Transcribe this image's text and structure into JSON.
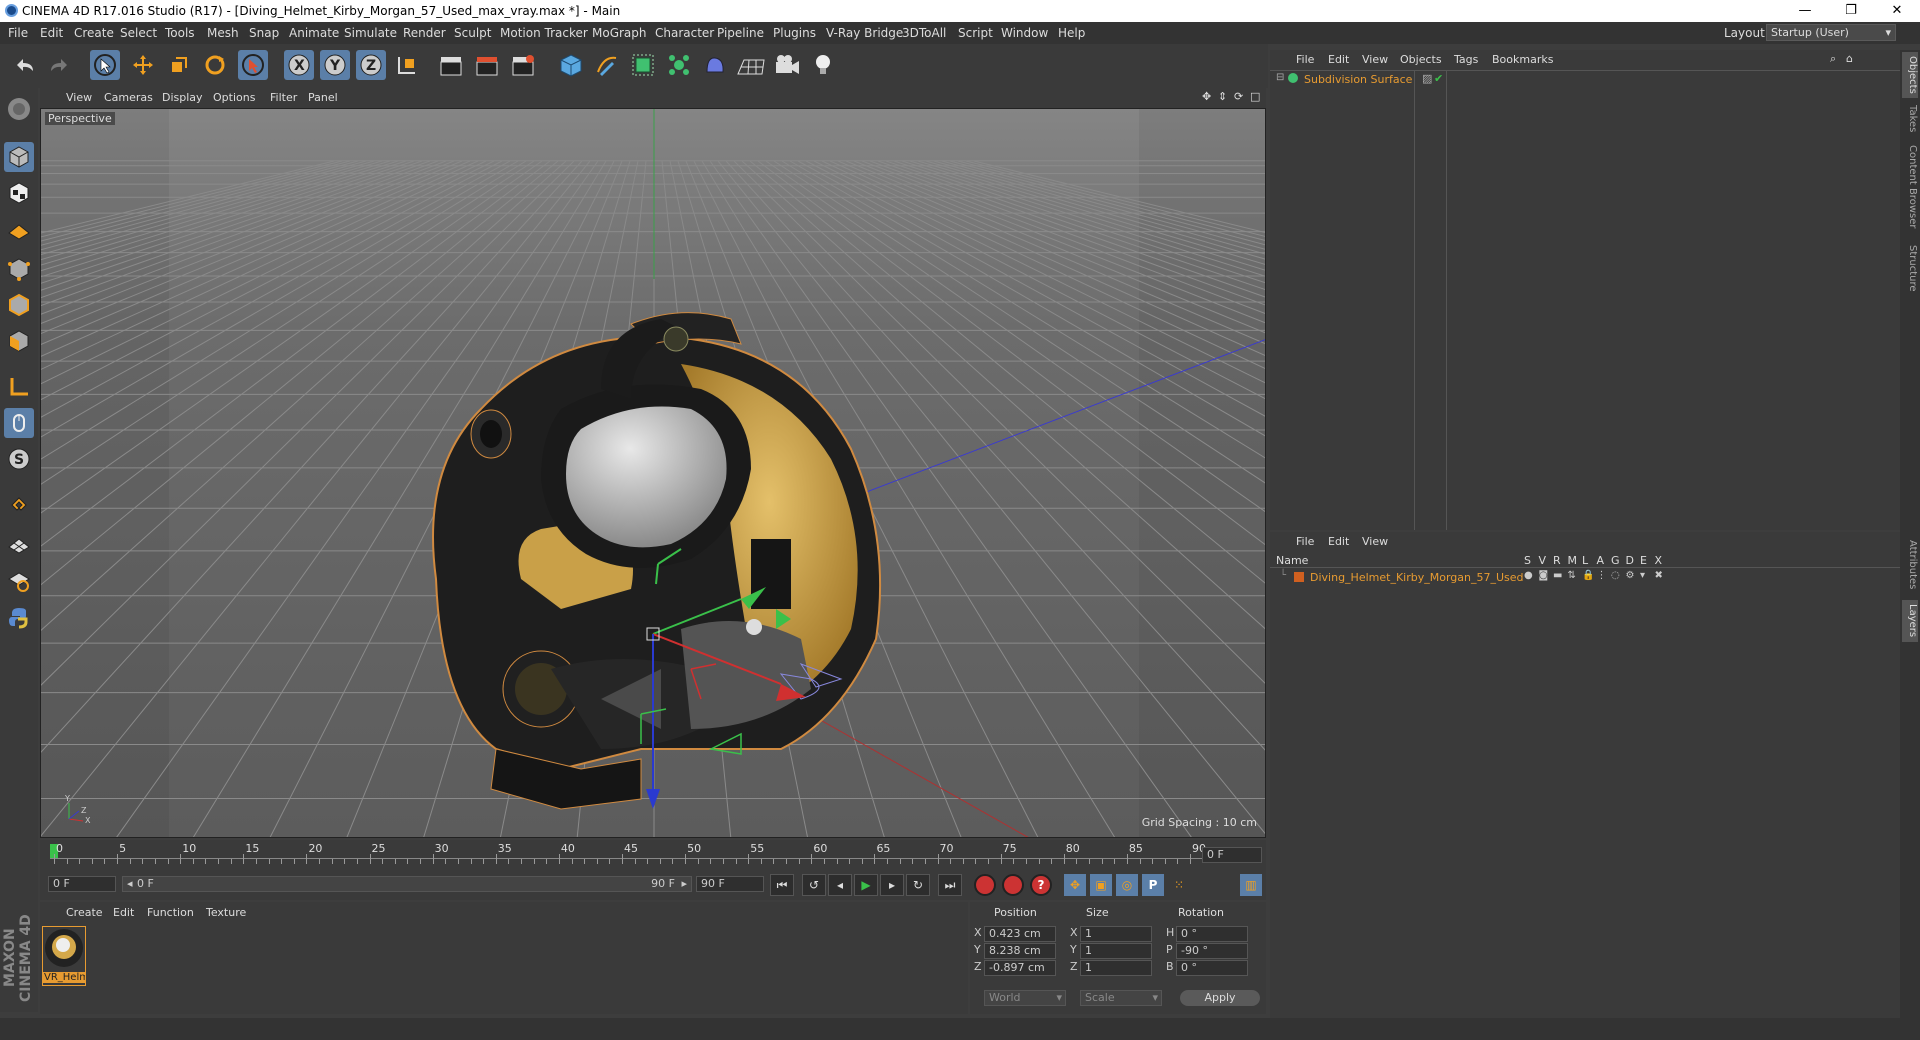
{
  "window": {
    "title": "CINEMA 4D R17.016 Studio (R17) - [Diving_Helmet_Kirby_Morgan_57_Used_max_vray.max *] - Main",
    "min": "—",
    "max": "❐",
    "close": "✕"
  },
  "menu": [
    "File",
    "Edit",
    "Create",
    "Select",
    "Tools",
    "Mesh",
    "Snap",
    "Animate",
    "Simulate",
    "Render",
    "Sculpt",
    "Motion Tracker",
    "MoGraph",
    "Character",
    "Pipeline",
    "Plugins",
    "V-Ray Bridge",
    "3DToAll",
    "Script",
    "Window",
    "Help"
  ],
  "layout": {
    "label": "Layout:",
    "value": "Startup (User)"
  },
  "viewport": {
    "menu": [
      "View",
      "Cameras",
      "Display",
      "Options",
      "Filter",
      "Panel"
    ],
    "label": "Perspective",
    "grid_spacing": "Grid Spacing : 10 cm"
  },
  "timeline": {
    "ticks": [
      "0",
      "5",
      "10",
      "15",
      "20",
      "25",
      "30",
      "35",
      "40",
      "45",
      "50",
      "55",
      "60",
      "65",
      "70",
      "75",
      "80",
      "85",
      "90"
    ],
    "current_frame": "0 F",
    "start": "0 F",
    "range_start": "0 F",
    "range_end": "90 F",
    "end": "90 F"
  },
  "material": {
    "menu": [
      "Create",
      "Edit",
      "Function",
      "Texture"
    ],
    "item": "VR_Helm"
  },
  "coords": {
    "headers": [
      "Position",
      "Size",
      "Rotation"
    ],
    "rows": [
      {
        "axis": "X",
        "pos": "0.423 cm",
        "size_axis": "X",
        "size": "1",
        "rot_axis": "H",
        "rot": "0 °"
      },
      {
        "axis": "Y",
        "pos": "8.238 cm",
        "size_axis": "Y",
        "size": "1",
        "rot_axis": "P",
        "rot": "-90 °"
      },
      {
        "axis": "Z",
        "pos": "-0.897 cm",
        "size_axis": "Z",
        "size": "1",
        "rot_axis": "B",
        "rot": "0 °"
      }
    ],
    "mode": "World",
    "scale": "Scale",
    "apply": "Apply"
  },
  "objects": {
    "menu": [
      "File",
      "Edit",
      "View",
      "Objects",
      "Tags",
      "Bookmarks"
    ],
    "item": "Subdivision Surface"
  },
  "layers": {
    "menu": [
      "File",
      "Edit",
      "View"
    ],
    "name_header": "Name",
    "cols": [
      "S",
      "V",
      "R",
      "M",
      "L",
      "A",
      "G",
      "D",
      "E",
      "X"
    ],
    "item": "Diving_Helmet_Kirby_Morgan_57_Used"
  },
  "side_tabs": [
    "Objects",
    "Takes",
    "Content Browser",
    "Structure",
    "Attributes",
    "Layers"
  ],
  "branding": "MAXON CINEMA 4D",
  "colors": {
    "accent": "#e79b31",
    "selected": "#5b7fa8",
    "helmet_yellow": "#d4a84a"
  }
}
